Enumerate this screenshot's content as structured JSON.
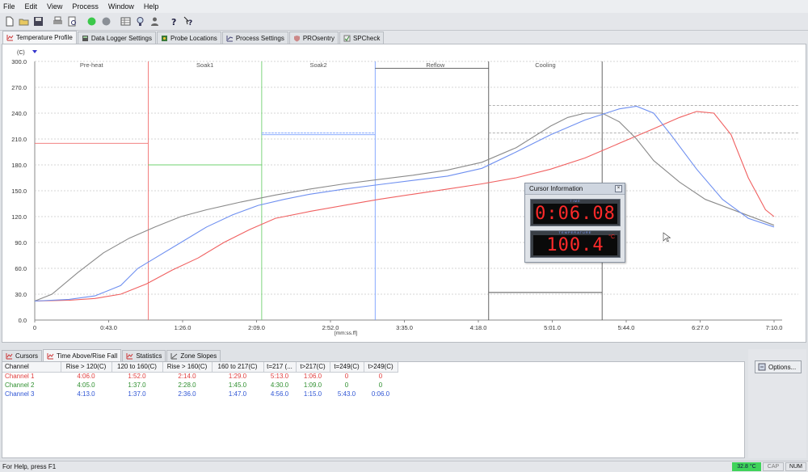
{
  "menu": [
    "File",
    "Edit",
    "View",
    "Process",
    "Window",
    "Help"
  ],
  "toolbar_icons": [
    "new-icon",
    "open-icon",
    "save-icon",
    "print-icon",
    "print-preview-icon",
    "run-green-icon",
    "stop-icon",
    "table-icon",
    "probe-icon",
    "user-icon",
    "help-icon",
    "context-help-icon"
  ],
  "tabs": [
    "Temperature Profile",
    "Data Logger Settings",
    "Probe Locations",
    "Process Settings",
    "PROsentry",
    "SPCheck"
  ],
  "active_tab": 0,
  "chart": {
    "ylabel": "(C)",
    "xlabel": "[mm:ss.ff]",
    "yticks": [
      "0.0",
      "30.0",
      "60.0",
      "90.0",
      "120.0",
      "150.0",
      "180.0",
      "210.0",
      "240.0",
      "270.0",
      "300.0"
    ],
    "xticks": [
      "0",
      "0:43.0",
      "1:26.0",
      "2:09.0",
      "2:52.0",
      "3:35.0",
      "4:18.0",
      "5:01.0",
      "5:44.0",
      "6:27.0",
      "7:10.0"
    ],
    "zones": [
      "Pre-heat",
      "Soak1",
      "Soak2",
      "Reflow",
      "Cooling"
    ]
  },
  "chart_data": {
    "type": "line",
    "ylabel": "(C)",
    "xlabel": "[mm:ss.ff]",
    "ylim": [
      0,
      300
    ],
    "xlim_seconds": [
      0,
      430
    ],
    "zones": [
      "Pre-heat",
      "Soak1",
      "Soak2",
      "Reflow",
      "Cooling"
    ],
    "series": [
      {
        "name": "Channel 1",
        "color": "#f06060",
        "x": [
          0,
          20,
          35,
          50,
          65,
          80,
          95,
          110,
          125,
          140,
          160,
          180,
          200,
          220,
          240,
          260,
          280,
          300,
          320,
          340,
          360,
          375,
          385,
          395,
          405,
          415,
          425,
          430
        ],
        "y": [
          22,
          23,
          25,
          30,
          42,
          58,
          72,
          90,
          105,
          118,
          126,
          133,
          140,
          146,
          152,
          158,
          165,
          175,
          188,
          205,
          222,
          235,
          242,
          240,
          215,
          165,
          128,
          120
        ]
      },
      {
        "name": "Channel 2",
        "color": "#8a8a8a",
        "x": [
          0,
          10,
          25,
          40,
          55,
          70,
          85,
          100,
          120,
          140,
          160,
          180,
          200,
          220,
          240,
          260,
          280,
          300,
          310,
          320,
          330,
          340,
          350,
          360,
          375,
          390,
          410,
          430
        ],
        "y": [
          22,
          30,
          55,
          78,
          95,
          108,
          120,
          128,
          137,
          145,
          152,
          158,
          163,
          168,
          174,
          183,
          200,
          225,
          235,
          240,
          240,
          230,
          210,
          185,
          160,
          140,
          125,
          110
        ]
      },
      {
        "name": "Channel 3",
        "color": "#6e8ff0",
        "x": [
          0,
          20,
          35,
          50,
          60,
          70,
          85,
          100,
          115,
          130,
          145,
          160,
          180,
          200,
          220,
          240,
          260,
          280,
          300,
          320,
          340,
          350,
          360,
          370,
          385,
          400,
          415,
          430
        ],
        "y": [
          22,
          24,
          28,
          40,
          60,
          72,
          90,
          108,
          122,
          133,
          140,
          146,
          152,
          157,
          162,
          167,
          176,
          195,
          215,
          232,
          245,
          248,
          240,
          215,
          175,
          140,
          118,
          108
        ]
      }
    ]
  },
  "cursor_info": {
    "title": "Cursor Information",
    "time_label": "TIME",
    "time": "0:06.08",
    "temp_label": "TEMPERATURE",
    "temp": "100.4",
    "temp_unit": "°C"
  },
  "bottom_tabs": [
    "Cursors",
    "Time Above/Rise Fall",
    "Statistics",
    "Zone Slopes"
  ],
  "active_bottom_tab": 1,
  "table": {
    "headers": [
      "Channel",
      "Rise > 120(C)",
      "120 to 160(C)",
      "Rise > 160(C)",
      "160 to 217(C)",
      "t=217 (...",
      "t>217(C)",
      "t=249(C)",
      "t>249(C)"
    ],
    "rows": [
      {
        "color": "#e03c3c",
        "cells": [
          "Channel 1",
          "4:06.0",
          "1:52.0",
          "2:14.0",
          "1:29.0",
          "5:13.0",
          "1:06.0",
          "0",
          "0"
        ]
      },
      {
        "color": "#2f8f2f",
        "cells": [
          "Channel 2",
          "4:05.0",
          "1:37.0",
          "2:28.0",
          "1:45.0",
          "4:30.0",
          "1:09.0",
          "0",
          "0"
        ]
      },
      {
        "color": "#2f55d4",
        "cells": [
          "Channel 3",
          "4:13.0",
          "1:37.0",
          "2:36.0",
          "1:47.0",
          "4:56.0",
          "1:15.0",
          "5:43.0",
          "0:06.0"
        ]
      }
    ]
  },
  "options_button": "Options...",
  "status": {
    "help": "For Help, press F1",
    "temp": "32.8 °C",
    "cap": "CAP",
    "num": "NUM"
  }
}
